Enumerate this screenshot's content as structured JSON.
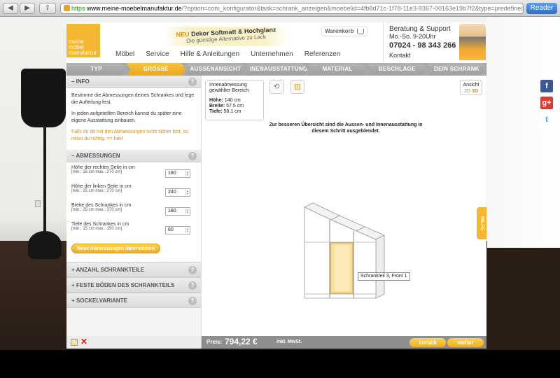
{
  "browser": {
    "scheme": "https",
    "host": "www.meine-moebelmanufaktur.de",
    "path": "/?option=com_konfigurator&task=schrank_anzeigen&moebelid=4fb8d71c-1f78-11e3-9367-00163e19b7f2&type=predefined&r",
    "reader_label": "Reader"
  },
  "header": {
    "logo_lines": [
      "meine",
      "möbel",
      "manufaktur"
    ],
    "promo_neu": "NEU",
    "promo_title": "Dekor Softmatt & Hochglanz",
    "promo_sub": "Die günstige Alternative zu Lack",
    "cart_label": "Warenkorb",
    "nav": [
      "Möbel",
      "Service",
      "Hilfe & Anleitungen",
      "Unternehmen",
      "Referenzen"
    ],
    "support": {
      "title": "Beratung & Support",
      "hours": "Mo.-So.  9-20Uhr",
      "phone": "07024 - 98 343 266",
      "contact": "Kontakt"
    }
  },
  "steps": [
    {
      "label": "TYP",
      "active": false
    },
    {
      "label": "GRÖSSE",
      "active": true
    },
    {
      "label": "AUSSENANSICHT",
      "active": false
    },
    {
      "label": "INNENAUSSTATTUNG",
      "active": false
    },
    {
      "label": "MATERIAL",
      "active": false
    },
    {
      "label": "BESCHLÄGE",
      "active": false
    },
    {
      "label": "DEIN SCHRANK",
      "active": false
    }
  ],
  "panel": {
    "info_title": "– INFO",
    "info_p1": "Bestimme die Abmessungen deines Schrankes und lege die Aufteilung fest.",
    "info_p2": "In jeden aufgeteilten Bereich kannst du später eine eigene Ausstattung einbauen.",
    "info_hint": "Falls du dir mit den Abmessungen nicht sicher bist, so misst du richtig. => hier!",
    "dims_title": "– ABMESSUNGEN",
    "dims": [
      {
        "label": "Höhe der rechten Seite in cm",
        "range": "[min.: 25 cm max.: 270 cm]",
        "value": "180"
      },
      {
        "label": "Höhe der linken Seite in cm",
        "range": "[min.: 25 cm max.: 270 cm]",
        "value": "240"
      },
      {
        "label": "Breite des Schrankes in cm",
        "range": "[min.: 25 cm max.: 370 cm]",
        "value": "180"
      },
      {
        "label": "Tiefe des Schrankes in cm",
        "range": "[min.: 15 cm max.: 150 cm]",
        "value": "60"
      }
    ],
    "apply_label": "Neue Abmessungen übernehmen",
    "collapsed": [
      "+ ANZAHL SCHRANKTEILE",
      "+ FESTE BÖDEN DES SCHRANKTEILS",
      "+ SOCKELVARIANTE"
    ],
    "help_glyph": "?"
  },
  "main": {
    "inner_title": "Innenabmessung gewählter Bereich:",
    "inner_height_label": "Höhe:",
    "inner_height": "140 cm",
    "inner_width_label": "Breite:",
    "inner_width": "57.5 cm",
    "inner_depth_label": "Tiefe:",
    "inner_depth": "58.1 cm",
    "view_label": "Ansicht",
    "view_2d": "2D",
    "view_3d": "3D",
    "notice": "Zur besseren Übersicht sind die Aussen- und Innenausstattung in diesem Schritt ausgeblendet.",
    "tooltip": "Schrankteil 3, Front 1",
    "help_tab": "HILFE"
  },
  "footer": {
    "price_label": "Preis:",
    "price_value": "794,22 €",
    "price_suffix": "inkl. MwSt.",
    "back_label": "zurück",
    "next_label": "weiter"
  },
  "social": [
    "f",
    "g+",
    "t"
  ],
  "colors": {
    "accent": "#f5b731",
    "step_active": "#f0b030",
    "step_inactive": "#a6a6a6",
    "hint": "#d98a12",
    "delete": "#d32020"
  }
}
